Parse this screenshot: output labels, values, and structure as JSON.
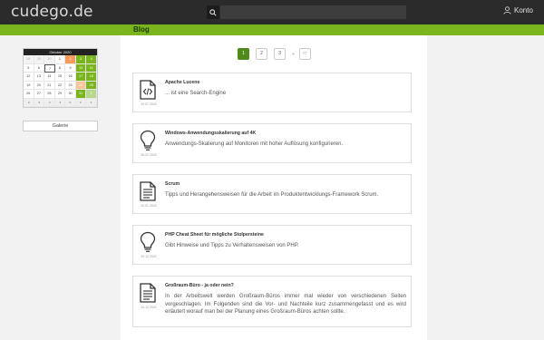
{
  "header": {
    "logo": "cudego.de",
    "search_placeholder": "",
    "account_label": "Konto"
  },
  "nav": {
    "blog_label": "Blog"
  },
  "calendar": {
    "title": "Oktober 2020",
    "rows": [
      [
        "28",
        "29",
        "30",
        "1",
        "2",
        "3",
        "4"
      ],
      [
        "5",
        "6",
        "7",
        "8",
        "9",
        "10",
        "11"
      ],
      [
        "12",
        "13",
        "14",
        "15",
        "16",
        "17",
        "18"
      ],
      [
        "19",
        "20",
        "21",
        "22",
        "23",
        "24",
        "25"
      ],
      [
        "26",
        "27",
        "28",
        "29",
        "30",
        "31",
        "1"
      ]
    ],
    "footer": [
      "◂",
      "◂",
      "◂",
      "◂",
      "▸",
      "▸",
      "▸"
    ]
  },
  "sidebar": {
    "gallery_label": "Galerie"
  },
  "pagination": {
    "pages": [
      "1",
      "2",
      "3",
      "»",
      "□"
    ]
  },
  "posts": [
    {
      "title": "Apache Lucene",
      "text": "... ist eine Search-Engine",
      "date": "29.07.2022",
      "icon": "code-file-icon"
    },
    {
      "title": "Windows-Anwendungsskalierung auf 4K",
      "text": "Anwendungs-Skalierung auf Monitoren mit hoher Auflösung konfigurieren.",
      "date": "28.02.2022",
      "icon": "lightbulb-icon"
    },
    {
      "title": "Scrum",
      "text": "Tipps und Herangehensweisen für die Arbeit im Produktentwicklungs-Framework Scrum.",
      "date": "20.01.2022",
      "icon": "document-icon"
    },
    {
      "title": "PHP Cheat Sheet für mögliche Stolpersteine",
      "text": "Gibt Hinweise und Tipps zu Verhaltensweisen von PHP.",
      "date": "29.12.2021",
      "icon": "lightbulb-icon"
    },
    {
      "title": "Großraum-Büro - ja oder nein?",
      "text": "In der Arbeitswelt werden Großraum-Büros immer mal wieder von verschiedenen Seiten vorgeschlagen. Im Folgenden sind die Vor- und Nachteile kurz zusammengefasst und es wird erläutert worauf man bei der Planung eines Großraum-Büros achten sollte.",
      "date": "24.12.2021",
      "icon": "document-icon"
    }
  ]
}
